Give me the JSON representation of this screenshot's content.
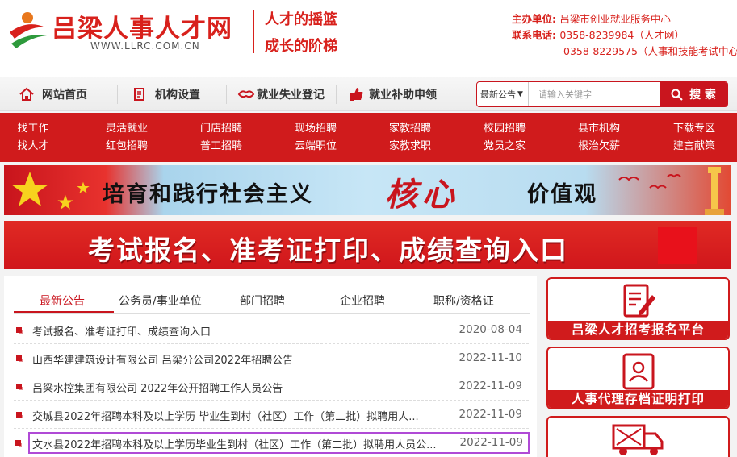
{
  "header": {
    "site_name": "吕梁人事人才网",
    "site_url": "WWW.LLRC.COM.CN",
    "slogan_line1": "人才的摇篮",
    "slogan_line2": "成长的阶梯",
    "sponsor_label": "主办单位:",
    "sponsor_value": "吕梁市创业就业服务中心",
    "phone_label": "联系电话:",
    "phone1": "0358-8239984（人才网）",
    "phone2": "0358-8229575（人事和技能考试中心）"
  },
  "nav": {
    "items": [
      {
        "label": "网站首页",
        "icon": "home-icon"
      },
      {
        "label": "机构设置",
        "icon": "document-icon"
      },
      {
        "label": "就业失业登记",
        "icon": "handshake-icon"
      },
      {
        "label": "就业补助申领",
        "icon": "thumbs-up-icon"
      }
    ]
  },
  "search": {
    "select_value": "最新公告",
    "placeholder": "请输入关键字",
    "button_label": "搜 索"
  },
  "red_menu": [
    [
      "找工作",
      "找人才"
    ],
    [
      "灵活就业",
      "红包招聘"
    ],
    [
      "门店招聘",
      "普工招聘"
    ],
    [
      "现场招聘",
      "云端职位"
    ],
    [
      "家教招聘",
      "家教求职"
    ],
    [
      "校园招聘",
      "党员之家"
    ],
    [
      "县市机构",
      "根治欠薪"
    ],
    [
      "下载专区",
      "建言献策"
    ]
  ],
  "banner1": {
    "text_left": "培育和践行社会主义",
    "text_core": "核心",
    "text_right": "价值观"
  },
  "banner2": {
    "text": "考试报名、准考证打印、成绩查询入口"
  },
  "notice": {
    "tabs": [
      "最新公告",
      "公务员/事业单位",
      "部门招聘",
      "企业招聘",
      "职称/资格证"
    ],
    "rows": [
      {
        "title": "考试报名、准考证打印、成绩查询入口",
        "date": "2020-08-04"
      },
      {
        "title": "山西华建建筑设计有限公司 吕梁分公司2022年招聘公告",
        "date": "2022-11-10"
      },
      {
        "title": "吕梁水控集团有限公司 2022年公开招聘工作人员公告",
        "date": "2022-11-09"
      },
      {
        "title": "交城县2022年招聘本科及以上学历 毕业生到村（社区）工作（第二批）拟聘用人...",
        "date": "2022-11-09"
      },
      {
        "title": "文水县2022年招聘本科及以上学历毕业生到村（社区）工作（第二批）拟聘用人员公...",
        "date": "2022-11-09"
      }
    ]
  },
  "side": {
    "box1_label": "吕梁人才招考报名平台",
    "box2_label": "人事代理存档证明打印"
  },
  "colors": {
    "brand_red": "#d01b1c",
    "highlight": "#b04ad6"
  }
}
